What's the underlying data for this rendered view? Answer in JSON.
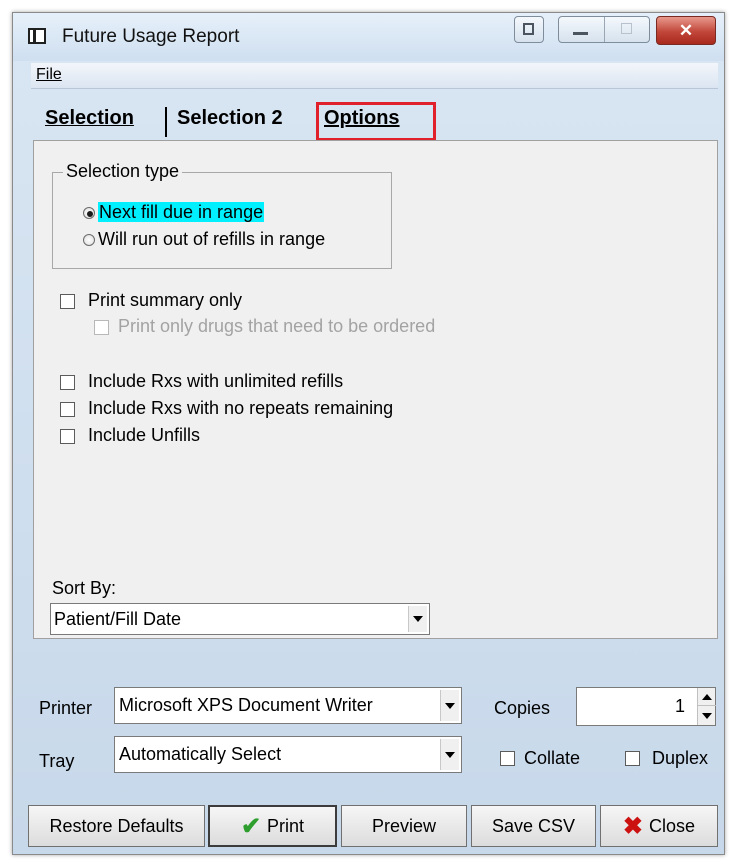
{
  "window": {
    "title": "Future Usage Report"
  },
  "menu": {
    "file": "File"
  },
  "tabs": [
    {
      "label": "Selection"
    },
    {
      "label": "Selection 2"
    },
    {
      "label": "Options",
      "active": true,
      "highlight_color": "#e0202a"
    }
  ],
  "options": {
    "selection_type": {
      "title": "Selection type",
      "radios": [
        {
          "label": "Next fill due in range",
          "selected": true
        },
        {
          "label": "Will run out of refills in range",
          "selected": false
        }
      ]
    },
    "print_summary": {
      "label": "Print summary only",
      "checked": false
    },
    "print_only_drugs": {
      "label": "Print only drugs that need to be ordered",
      "checked": false,
      "disabled": true
    },
    "include_unlimited": {
      "label": "Include Rxs with unlimited refills",
      "checked": false
    },
    "include_no_repeats": {
      "label": "Include Rxs with no repeats remaining",
      "checked": false
    },
    "include_unfills": {
      "label": "Include Unfills",
      "checked": false
    },
    "sort_by": {
      "label": "Sort By:",
      "value": "Patient/Fill Date"
    }
  },
  "print_settings": {
    "printer_label": "Printer",
    "printer_value": "Microsoft XPS Document Writer",
    "tray_label": "Tray",
    "tray_value": "Automatically Select",
    "copies_label": "Copies",
    "copies_value": "1",
    "collate_label": "Collate",
    "duplex_label": "Duplex"
  },
  "buttons": {
    "restore": "Restore Defaults",
    "print": "Print",
    "preview": "Preview",
    "save_csv": "Save CSV",
    "close": "Close"
  },
  "colors": {
    "highlight": "#00f0ff",
    "tab_outline": "#e0202a",
    "close_x": "#cc1111",
    "print_check": "#2e9e2e"
  }
}
